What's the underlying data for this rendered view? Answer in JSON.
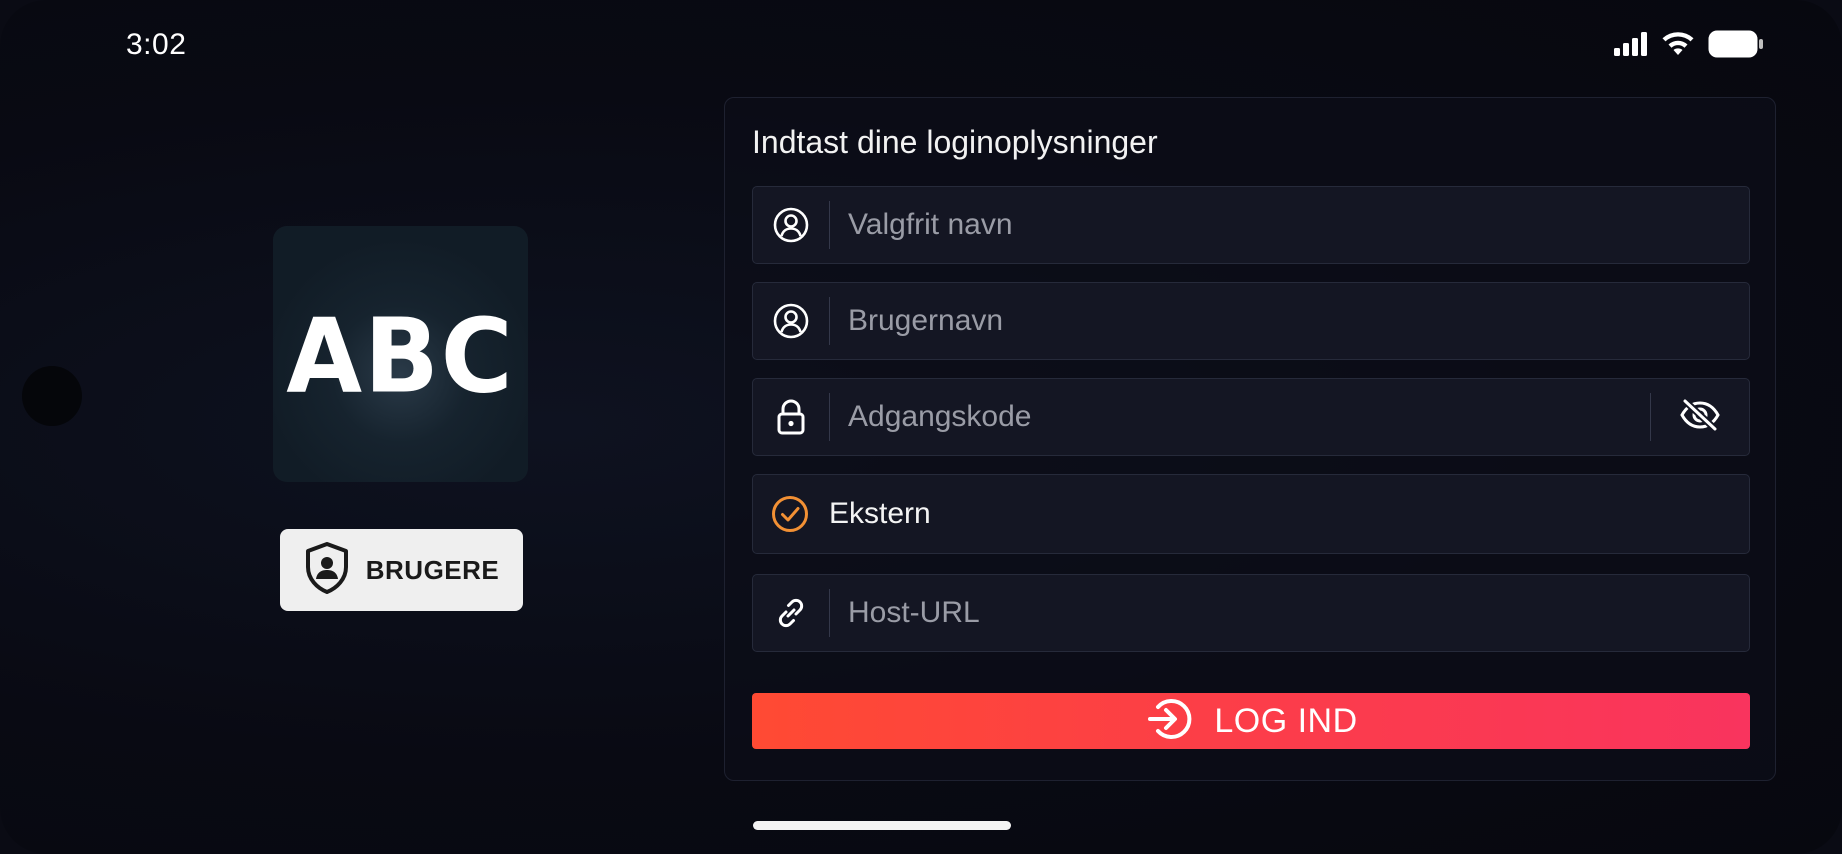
{
  "status_bar": {
    "time": "3:02",
    "icons": [
      "signal-icon",
      "wifi-icon",
      "battery-icon"
    ]
  },
  "branding": {
    "logo_text": "ABC",
    "users_button_label": "BRUGERE"
  },
  "form": {
    "title": "Indtast dine loginoplysninger",
    "fields": {
      "name": {
        "placeholder": "Valgfrit navn",
        "value": "",
        "icon": "user-circle-icon"
      },
      "username": {
        "placeholder": "Brugernavn",
        "value": "",
        "icon": "user-circle-icon"
      },
      "password": {
        "placeholder": "Adgangskode",
        "value": "",
        "icon": "lock-icon",
        "toggle_icon": "eye-off-icon"
      },
      "external": {
        "label": "Ekstern",
        "checked": true,
        "icon": "check-circle-icon"
      },
      "host_url": {
        "placeholder": "Host-URL",
        "value": "",
        "icon": "link-icon"
      }
    },
    "login_button_label": "LOG IND"
  },
  "colors": {
    "accent_orange": "#f29034",
    "login_gradient_start": "#ff4a33",
    "login_gradient_end": "#f9345e",
    "background": "#0a0b14",
    "field_background": "#141623"
  }
}
